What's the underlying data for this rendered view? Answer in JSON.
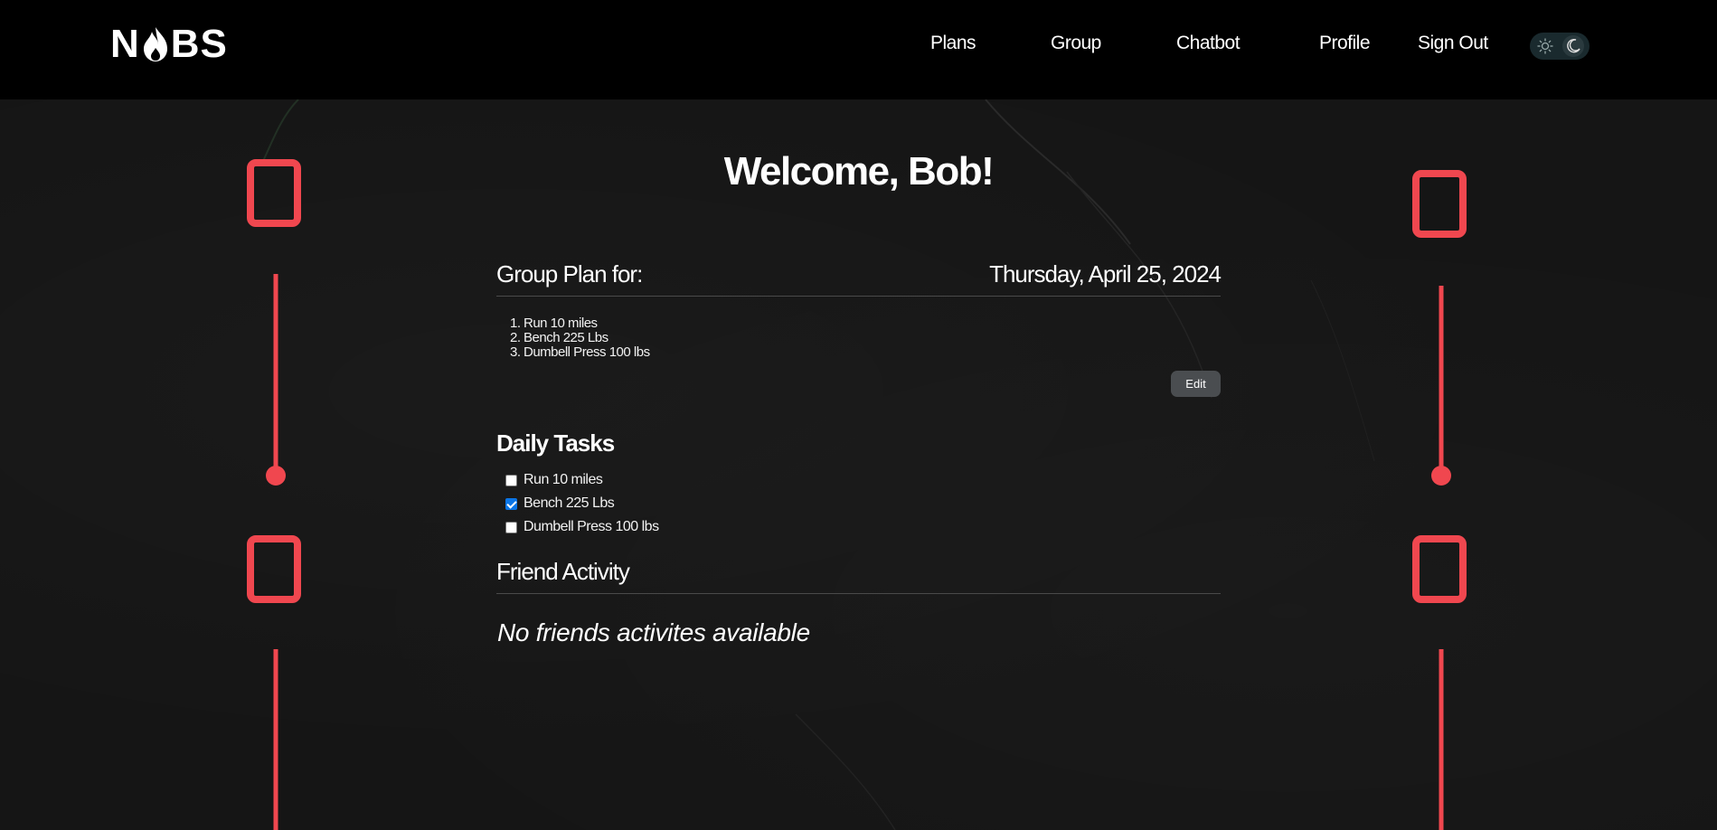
{
  "app": {
    "logo_text_left": "N",
    "logo_text_right": "BS",
    "brand_color": "#f0474f"
  },
  "nav": {
    "plans": "Plans",
    "group": "Group",
    "chatbot": "Chatbot",
    "profile": "Profile",
    "sign_out": "Sign Out"
  },
  "theme_toggle": {
    "light_icon": "sun-icon",
    "dark_icon": "moon-icon",
    "mode": "dark"
  },
  "main": {
    "welcome": "Welcome, Bob!",
    "group_plan": {
      "label": "Group Plan for:",
      "date": "Thursday, April 25, 2024",
      "items": [
        {
          "num": "1.",
          "text": "Run 10 miles"
        },
        {
          "num": "2.",
          "text": "Bench 225 Lbs"
        },
        {
          "num": "3.",
          "text": "Dumbell Press 100 lbs"
        }
      ],
      "edit_label": "Edit"
    },
    "daily_tasks": {
      "title": "Daily Tasks",
      "tasks": [
        {
          "text": "Run 10 miles",
          "checked": false
        },
        {
          "text": "Bench 225 Lbs",
          "checked": true
        },
        {
          "text": "Dumbell Press 100 lbs",
          "checked": false
        }
      ]
    },
    "friend_activity": {
      "title": "Friend Activity",
      "empty_message": "No friends activites available"
    }
  }
}
